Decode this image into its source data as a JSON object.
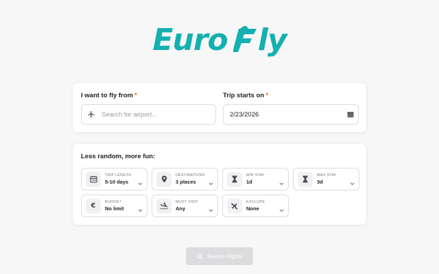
{
  "logo": {
    "part1": "Euro",
    "part2": "ly"
  },
  "departure": {
    "label": "I want to fly from",
    "required": "*",
    "placeholder": "Search for airport..."
  },
  "date": {
    "label": "Trip starts on",
    "required": "*",
    "value": "2/23/2026"
  },
  "options_section": {
    "title": "Less random, more fun:",
    "items": [
      {
        "label": "TRIP LENGTH",
        "value": "5-10 days",
        "icon": "calendar-icon"
      },
      {
        "label": "DESTINATIONS",
        "value": "3 places",
        "icon": "map-pin-icon"
      },
      {
        "label": "MIN STAY",
        "value": "1d",
        "icon": "hourglass-icon"
      },
      {
        "label": "MAX STAY",
        "value": "3d",
        "icon": "hourglass-icon"
      },
      {
        "label": "BUDGET",
        "value": "No limit",
        "icon": "euro-icon"
      },
      {
        "label": "MUST VISIT",
        "value": "Any",
        "icon": "plane-landing-icon"
      },
      {
        "label": "EXCLUDE",
        "value": "None",
        "icon": "plane-off-icon"
      }
    ]
  },
  "search_button": {
    "label": "Search Flights",
    "icon": "search-icon"
  },
  "colors": {
    "brand": "#14b0b0",
    "required": "#e8641c",
    "button_disabled": "#dcdcde"
  }
}
